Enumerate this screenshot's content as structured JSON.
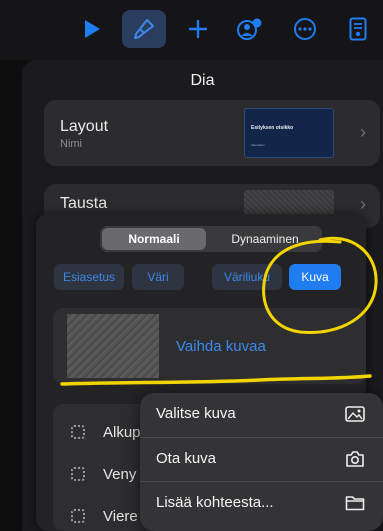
{
  "toolbar": {
    "buttons": [
      {
        "name": "play-icon"
      },
      {
        "name": "brush-icon",
        "active": true
      },
      {
        "name": "plus-icon"
      },
      {
        "name": "collaborate-icon"
      },
      {
        "name": "more-icon"
      },
      {
        "name": "document-icon"
      }
    ],
    "accent": "#1f7cf1"
  },
  "panel": {
    "title": "Dia",
    "layout": {
      "label": "Layout",
      "sub": "Nimi",
      "thumb_title": "Esityksen otsikko",
      "thumb_sub": "Alaotsikko"
    },
    "background": {
      "label": "Tausta"
    }
  },
  "popup": {
    "segments": [
      {
        "label": "Normaali",
        "selected": true
      },
      {
        "label": "Dynaaminen",
        "selected": false
      }
    ],
    "fill_tabs": [
      {
        "label": "Esiasetus",
        "selected": false
      },
      {
        "label": "Väri",
        "selected": false
      },
      {
        "label": "Väriliuku",
        "selected": false
      },
      {
        "label": "Kuva",
        "selected": true
      }
    ],
    "replace_label": "Vaihda kuvaa",
    "options": [
      {
        "label": "Alkup",
        "icon": "original-size-icon"
      },
      {
        "label": "Veny",
        "icon": "stretch-icon"
      },
      {
        "label": "Viere",
        "icon": "tile-icon"
      }
    ]
  },
  "menu": {
    "items": [
      {
        "label": "Valitse kuva",
        "icon": "photo-icon"
      },
      {
        "label": "Ota kuva",
        "icon": "camera-icon"
      },
      {
        "label": "Lisää kohteesta...",
        "icon": "folder-icon"
      }
    ]
  },
  "annotation_color": "#f2d400"
}
